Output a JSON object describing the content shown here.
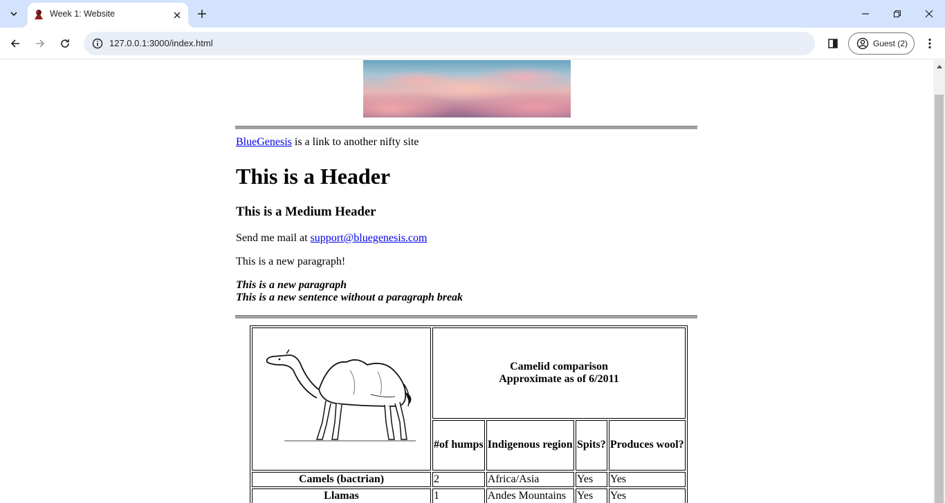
{
  "browser": {
    "tab_title": "Week 1: Website",
    "url": "127.0.0.1:3000/index.html",
    "profile_label": "Guest (2)"
  },
  "page": {
    "link_text": "BlueGenesis",
    "link_suffix": " is a link to another nifty site",
    "header": "This is a Header",
    "medium_header": "This is a Medium Header",
    "mail_prefix": "Send me mail at ",
    "mail_link": "support@bluegenesis.com",
    "paragraph": "This is a new paragraph!",
    "italic_line1": "This is a new paragraph",
    "italic_line2": "This is a new sentence without a paragraph break"
  },
  "table": {
    "caption_line1": "Camelid comparison",
    "caption_line2": "Approximate as of 6/2011",
    "columns": [
      "#of humps",
      "Indigenous region",
      "Spits?",
      "Produces wool?"
    ],
    "rows": [
      {
        "name": "Camels (bactrian)",
        "cells": [
          "2",
          "Africa/Asia",
          "Yes",
          "Yes"
        ]
      },
      {
        "name": "Llamas",
        "cells": [
          "1",
          "Andes Mountains",
          "Yes",
          "Yes"
        ]
      }
    ]
  }
}
